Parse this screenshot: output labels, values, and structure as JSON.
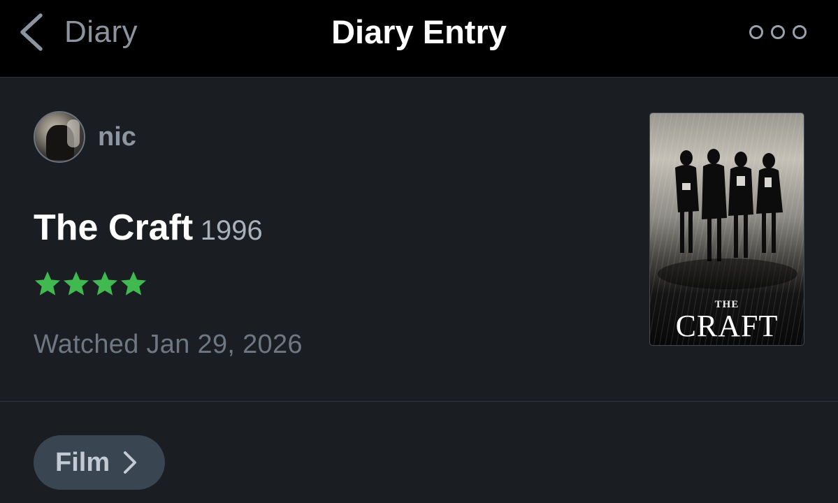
{
  "nav": {
    "back_label": "Diary",
    "title": "Diary Entry",
    "more_icon": "more-options-icon"
  },
  "entry": {
    "username": "nic",
    "film_title": "The Craft",
    "film_year": "1996",
    "rating": {
      "stars": 4,
      "max": 5,
      "color": "#3fb950"
    },
    "watched": "Watched Jan 29, 2026",
    "poster": {
      "title_small": "THE",
      "title_large": "CRAFT"
    }
  },
  "chip": {
    "label": "Film",
    "icon": "chevron-right-icon"
  },
  "colors": {
    "background": "#1a1d22",
    "nav_background": "#000000",
    "chip_background": "#3a4552"
  }
}
